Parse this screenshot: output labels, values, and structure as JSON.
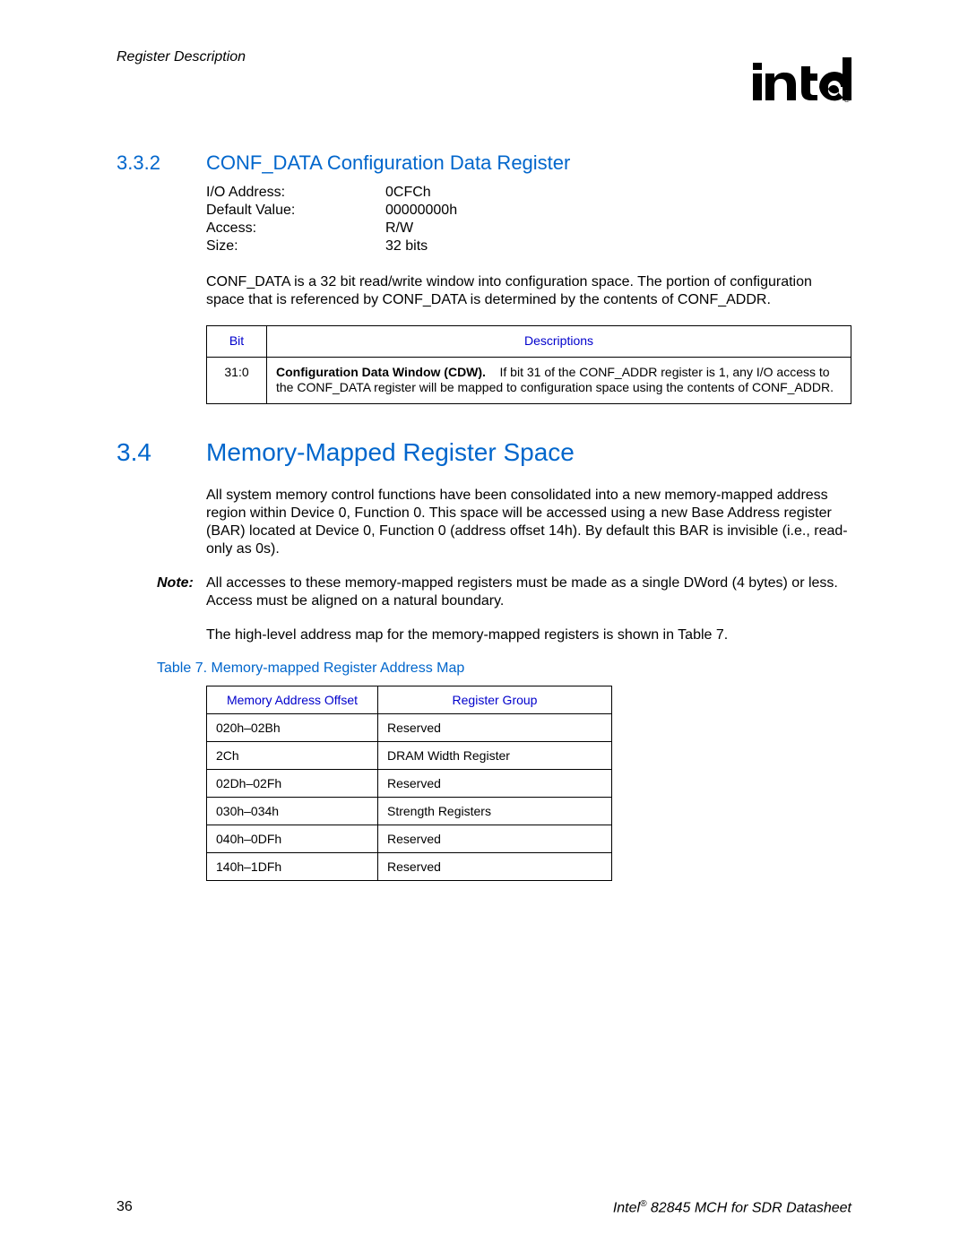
{
  "header": {
    "running_head": "Register Description",
    "logo_alt": "intel"
  },
  "section332": {
    "number": "3.3.2",
    "title": "CONF_DATA Configuration Data Register",
    "kv": {
      "labels": {
        "io_address": "I/O Address:",
        "default_value": "Default Value:",
        "access": "Access:",
        "size": "Size:"
      },
      "values": {
        "io_address": "0CFCh",
        "default_value": "00000000h",
        "access": "R/W",
        "size": "32 bits"
      }
    },
    "description": "CONF_DATA is a 32 bit read/write window into configuration space. The portion of configuration space that is referenced by CONF_DATA is determined by the contents of CONF_ADDR.",
    "bit_table": {
      "headers": {
        "bit": "Bit",
        "desc": "Descriptions"
      },
      "row": {
        "bit": "31:0",
        "bold": "Configuration Data Window (CDW).",
        "rest": "If bit 31 of the CONF_ADDR register is 1, any I/O access to the CONF_DATA register will be mapped to configuration space using the contents of CONF_ADDR."
      }
    }
  },
  "section34": {
    "number": "3.4",
    "title": "Memory-Mapped Register Space",
    "para1": "All system memory control functions have been consolidated into a new memory-mapped address region within Device 0, Function 0. This space will be accessed using a new Base Address register (BAR) located at Device 0, Function 0 (address offset 14h). By default this BAR is invisible (i.e., read-only as 0s).",
    "note_label": "Note:",
    "note_body": "All accesses to these memory-mapped registers must be made as a single DWord (4 bytes) or less. Access must be aligned on a natural boundary.",
    "para2": "The high-level address map for the memory-mapped registers is shown in Table 7.",
    "table_caption": "Table 7. Memory-mapped Register Address Map",
    "addr_table": {
      "headers": {
        "offset": "Memory Address Offset",
        "group": "Register Group"
      },
      "rows": [
        {
          "offset": "020h–02Bh",
          "group": "Reserved"
        },
        {
          "offset": "2Ch",
          "group": "DRAM Width Register"
        },
        {
          "offset": "02Dh–02Fh",
          "group": "Reserved"
        },
        {
          "offset": "030h–034h",
          "group": "Strength Registers"
        },
        {
          "offset": "040h–0DFh",
          "group": "Reserved"
        },
        {
          "offset": "140h–1DFh",
          "group": "Reserved"
        }
      ]
    }
  },
  "footer": {
    "page_number": "36",
    "doc_prefix": "Intel",
    "doc_reg": "®",
    "doc_suffix": " 82845 MCH for SDR Datasheet"
  }
}
